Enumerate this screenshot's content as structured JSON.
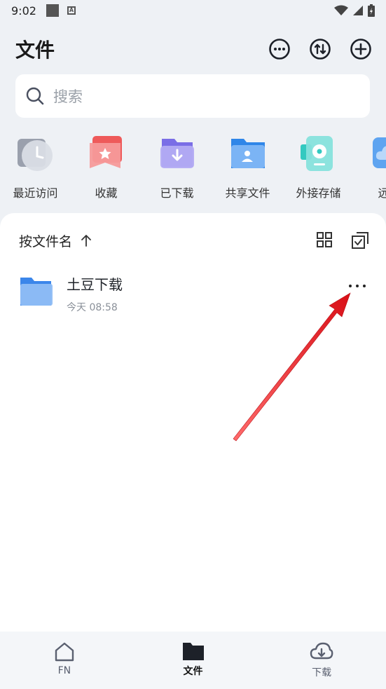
{
  "status_bar": {
    "time": "9:02"
  },
  "header": {
    "title": "文件"
  },
  "search": {
    "placeholder": "搜索"
  },
  "quick_access": [
    {
      "label": "最近访问",
      "icon": "clock-icon"
    },
    {
      "label": "收藏",
      "icon": "star-icon"
    },
    {
      "label": "已下载",
      "icon": "download-folder-icon"
    },
    {
      "label": "共享文件",
      "icon": "shared-folder-icon"
    },
    {
      "label": "外接存储",
      "icon": "external-storage-icon"
    },
    {
      "label": "远程",
      "icon": "cloud-icon"
    }
  ],
  "sort": {
    "label": "按文件名"
  },
  "files": [
    {
      "name": "土豆下载",
      "date": "今天 08:58"
    }
  ],
  "bottom_nav": [
    {
      "label": "FN",
      "icon": "home-icon"
    },
    {
      "label": "文件",
      "icon": "folder-icon",
      "active": true
    },
    {
      "label": "下载",
      "icon": "cloud-download-icon"
    }
  ],
  "colors": {
    "accent": "#1d2129",
    "annotation": "#e0151b"
  }
}
